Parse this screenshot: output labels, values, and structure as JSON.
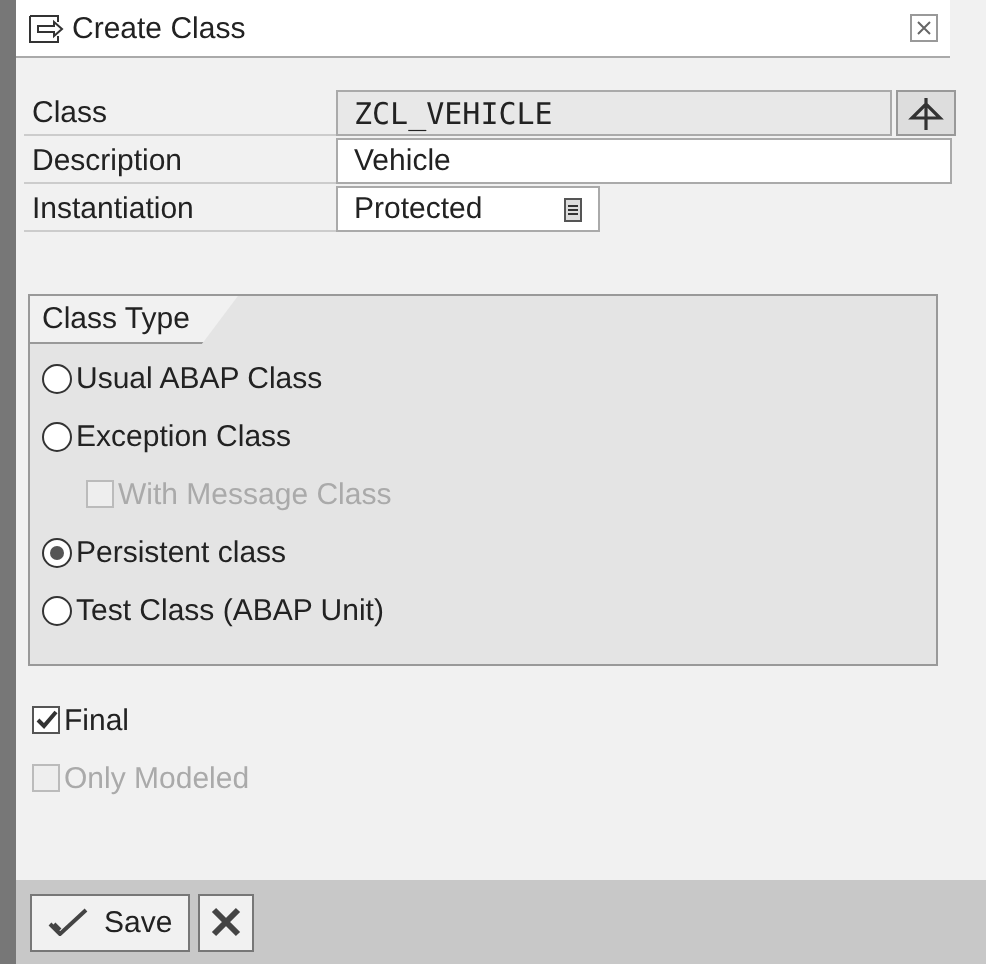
{
  "window": {
    "title": "Create Class"
  },
  "fields": [
    {
      "label": "Class",
      "value": "ZCL_VEHICLE",
      "kind": "readonly"
    },
    {
      "label": "Description",
      "value": "Vehicle",
      "kind": "input"
    },
    {
      "label": "Instantiation",
      "value": "Protected",
      "kind": "dropdown"
    }
  ],
  "class_type": {
    "title": "Class Type",
    "options": [
      {
        "label": "Usual ABAP Class",
        "kind": "radio",
        "selected": false,
        "disabled": false
      },
      {
        "label": "Exception Class",
        "kind": "radio",
        "selected": false,
        "disabled": false
      },
      {
        "label": "With Message Class",
        "kind": "checkbox",
        "checked": false,
        "disabled": true
      },
      {
        "label": "Persistent class",
        "kind": "radio",
        "selected": true,
        "disabled": false
      },
      {
        "label": "Test Class (ABAP Unit)",
        "kind": "radio",
        "selected": false,
        "disabled": false
      }
    ]
  },
  "flags": [
    {
      "label": "Final",
      "checked": true,
      "disabled": false
    },
    {
      "label": "Only Modeled",
      "checked": false,
      "disabled": true
    }
  ],
  "buttons": [
    {
      "label": "Save",
      "kind": "save"
    },
    {
      "kind": "cancel"
    }
  ]
}
